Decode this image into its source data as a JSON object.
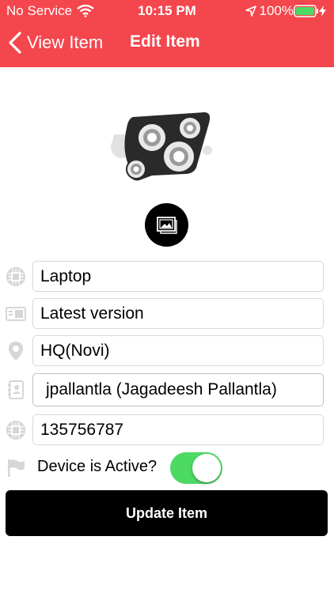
{
  "status_bar": {
    "carrier": "No Service",
    "time": "10:15 PM",
    "battery": "100%"
  },
  "nav": {
    "back_label": "View Item",
    "title": "Edit Item"
  },
  "icons": {
    "hero": "gears-icon",
    "image_picker": "image-icon",
    "name": "chip-icon",
    "description": "card-icon",
    "location": "location-pin-icon",
    "owner": "contact-book-icon",
    "serial": "chip-icon",
    "active": "flag-icon"
  },
  "form": {
    "name_value": "Laptop",
    "description_value": "Latest version",
    "location_value": "HQ(Novi)",
    "owner_value": "jpallantla (Jagadeesh  Pallantla)",
    "serial_value": "135756787",
    "active_label": "Device is Active?",
    "active_on": true
  },
  "actions": {
    "update_label": "Update Item"
  },
  "colors": {
    "header": "#f4464d",
    "switch_on": "#4cd964",
    "button": "#000000",
    "icon_gray": "#d6d6d6"
  }
}
